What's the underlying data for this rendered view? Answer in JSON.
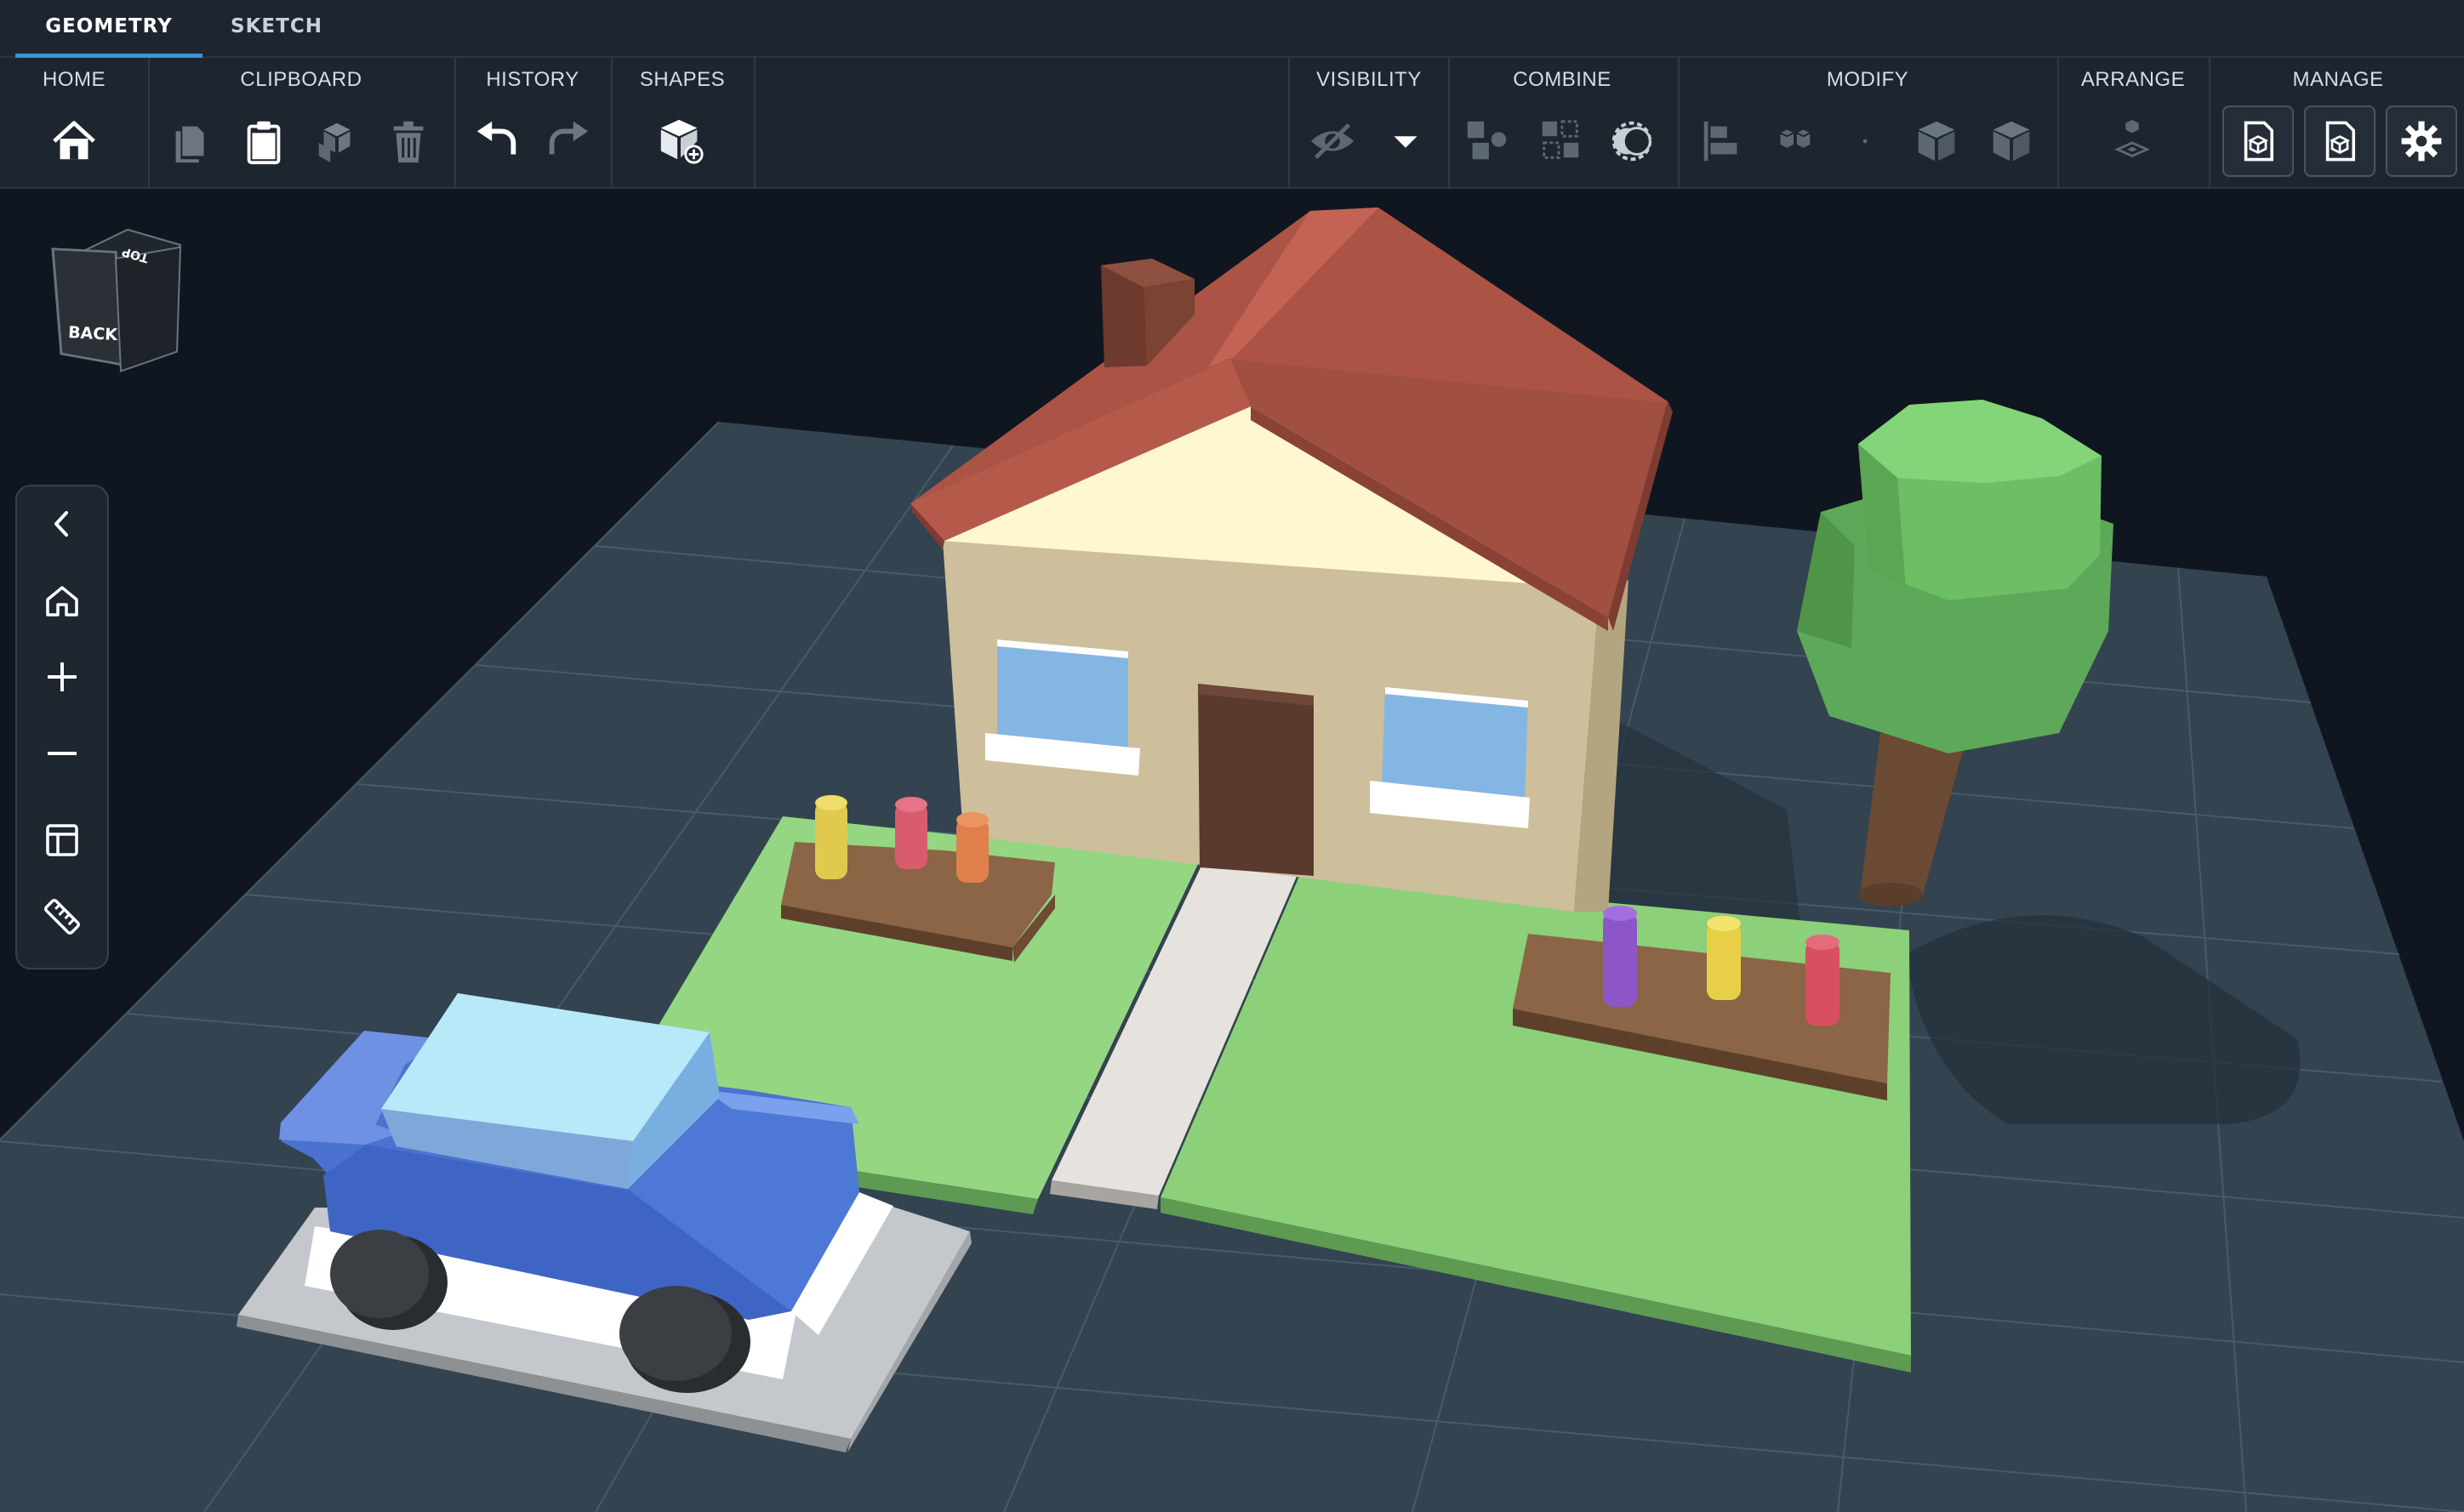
{
  "tabs": [
    {
      "label": "GEOMETRY",
      "active": true
    },
    {
      "label": "SKETCH",
      "active": false
    }
  ],
  "ribbon": {
    "groups": [
      {
        "label": "HOME",
        "tools": [
          "home-icon"
        ]
      },
      {
        "label": "CLIPBOARD",
        "tools": [
          "copy-icon",
          "paste-icon",
          "duplicate-icon",
          "delete-icon"
        ]
      },
      {
        "label": "HISTORY",
        "tools": [
          "undo-icon",
          "redo-icon"
        ]
      },
      {
        "label": "SHAPES",
        "tools": [
          "add-shape-icon"
        ]
      },
      {
        "label": "VISIBILITY",
        "tools": [
          "hide-icon",
          "dropdown-icon"
        ]
      },
      {
        "label": "COMBINE",
        "tools": [
          "union-icon",
          "subtract-icon",
          "intersect-icon"
        ]
      },
      {
        "label": "MODIFY",
        "tools": [
          "align-icon",
          "pattern-icon",
          "dot-icon",
          "mirror-icon",
          "scale-icon"
        ]
      },
      {
        "label": "ARRANGE",
        "tools": [
          "arrange-icon"
        ]
      },
      {
        "label": "MANAGE",
        "tools": [
          "import-icon",
          "export-icon",
          "settings-icon"
        ]
      }
    ]
  },
  "viewcube": {
    "front": "BACK",
    "top": "TOP"
  },
  "leftnav": {
    "tools": [
      "collapse-icon",
      "home-view-icon",
      "zoom-in-icon",
      "zoom-out-icon",
      "layout-icon",
      "ruler-icon"
    ]
  },
  "colors": {
    "toolbar_bg": "#1d252f",
    "accent": "#3a93d6",
    "viewport_bg": "#0f1620",
    "grid_plate": "#33434f",
    "roof": "#ab5446",
    "walls": "#cdbf9b",
    "grass": "#8fd17a",
    "car": "#5c85db",
    "tree_leaves": "#5ea85a"
  }
}
